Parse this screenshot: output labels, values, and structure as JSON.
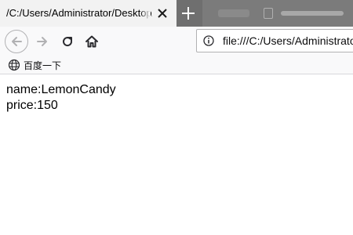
{
  "tabs": {
    "active_title": "/C:/Users/Administrator/Desktop/",
    "new_tab_symbol": "+"
  },
  "toolbar": {
    "url": "file:///C:/Users/Administrator/Desktop/"
  },
  "bookmarks": {
    "items": [
      {
        "label": "百度一下",
        "icon": "globe-icon"
      }
    ]
  },
  "page": {
    "lines": [
      "name:LemonCandy",
      "price:150"
    ]
  },
  "colors": {
    "tabstrip": "#6f6f6f",
    "active_tab": "#f2f2f2",
    "toolbar": "#f9f9fa",
    "icon": "#2a2a2e"
  }
}
